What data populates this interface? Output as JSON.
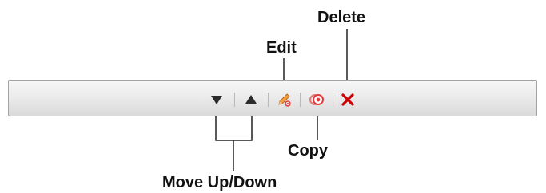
{
  "toolbar": {
    "buttons": [
      {
        "id": "move-down",
        "icon": "triangle-down-icon",
        "color": "#2b2b2b"
      },
      {
        "id": "move-up",
        "icon": "triangle-up-icon",
        "color": "#2b2b2b"
      },
      {
        "id": "edit",
        "icon": "pencil-icon",
        "color": "#e07b2f"
      },
      {
        "id": "copy",
        "icon": "copy-icon",
        "color": "#e03a3a"
      },
      {
        "id": "delete",
        "icon": "close-icon",
        "color": "#cc0000"
      }
    ]
  },
  "labels": {
    "delete": "Delete",
    "edit": "Edit",
    "copy": "Copy",
    "move": "Move Up/Down"
  }
}
